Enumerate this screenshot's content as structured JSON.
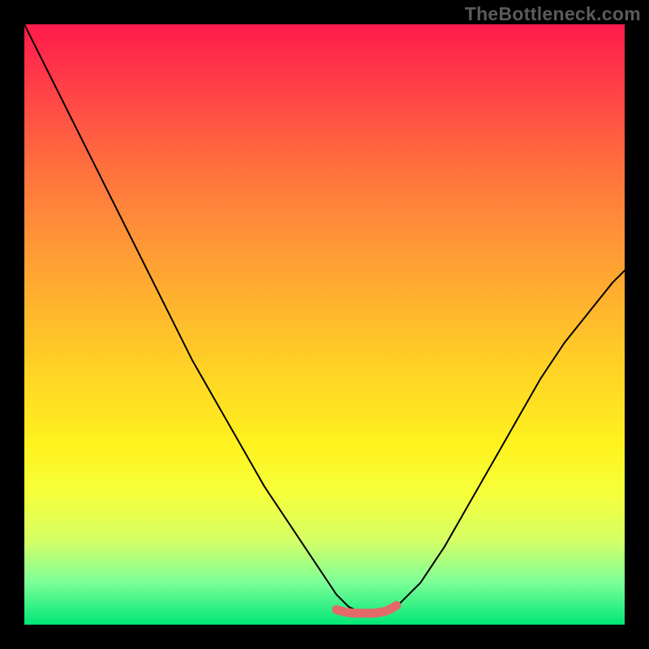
{
  "watermark": "TheBottleneck.com",
  "chart_data": {
    "type": "line",
    "title": "",
    "xlabel": "",
    "ylabel": "",
    "xlim": [
      0,
      100
    ],
    "ylim": [
      0,
      100
    ],
    "grid": false,
    "series": [
      {
        "name": "bottleneck-curve",
        "x": [
          0,
          4,
          8,
          12,
          16,
          20,
          24,
          28,
          32,
          36,
          40,
          44,
          48,
          52,
          54,
          56,
          58,
          60,
          62,
          66,
          70,
          74,
          78,
          82,
          86,
          90,
          94,
          98,
          100
        ],
        "y": [
          100,
          92,
          84,
          76,
          68,
          60,
          52,
          44,
          37,
          30,
          23,
          17,
          11,
          5,
          3,
          2,
          2,
          2,
          3,
          7,
          13,
          20,
          27,
          34,
          41,
          47,
          52,
          57,
          59
        ]
      },
      {
        "name": "optimal-marker",
        "x": [
          52,
          53,
          54,
          55,
          56,
          57,
          58,
          59,
          60,
          61,
          62
        ],
        "y": [
          2.5,
          2.2,
          2.0,
          1.9,
          1.9,
          1.9,
          1.9,
          2.0,
          2.2,
          2.6,
          3.2
        ]
      }
    ],
    "background_gradient": {
      "direction": "vertical",
      "stops": [
        {
          "pos": 0.0,
          "color": "#ff1a4c"
        },
        {
          "pos": 0.1,
          "color": "#ff3e48"
        },
        {
          "pos": 0.22,
          "color": "#ff6a3f"
        },
        {
          "pos": 0.34,
          "color": "#ff8f38"
        },
        {
          "pos": 0.46,
          "color": "#ffb22e"
        },
        {
          "pos": 0.58,
          "color": "#ffd425"
        },
        {
          "pos": 0.7,
          "color": "#fff21e"
        },
        {
          "pos": 0.78,
          "color": "#f6ff3a"
        },
        {
          "pos": 0.86,
          "color": "#d5ff66"
        },
        {
          "pos": 0.93,
          "color": "#7cff97"
        },
        {
          "pos": 1.0,
          "color": "#00e676"
        }
      ]
    }
  }
}
